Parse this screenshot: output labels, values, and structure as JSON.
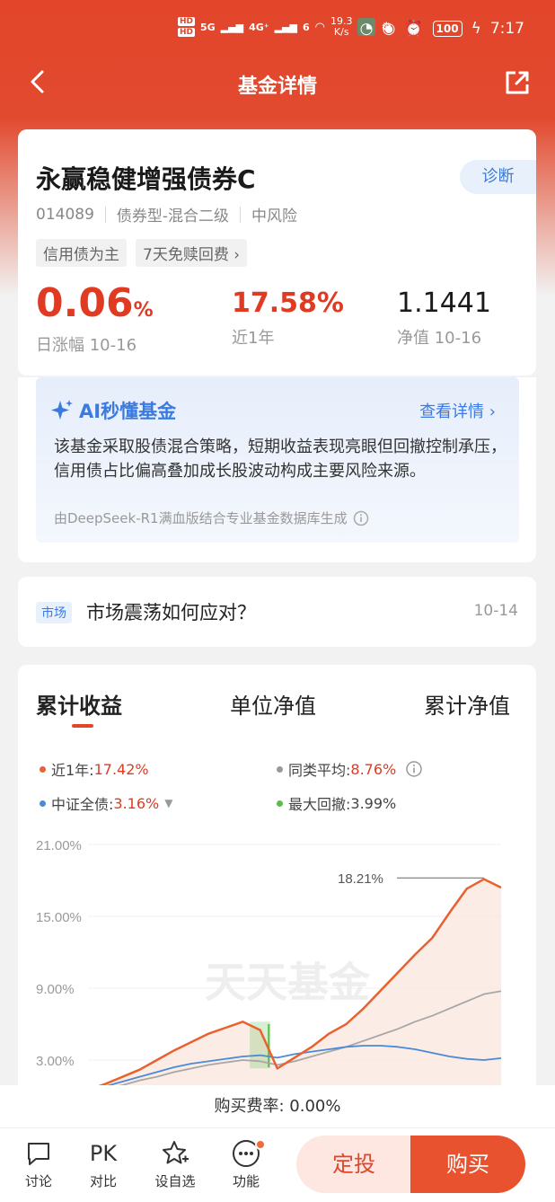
{
  "status_bar": {
    "hd1": "HD",
    "hd2": "HD",
    "net1": "5G",
    "net2": "4G⁺",
    "wifi_num": "6",
    "speed_val": "19.3",
    "speed_unit": "K/s",
    "battery": "100",
    "time": "7:17"
  },
  "nav": {
    "title": "基金详情",
    "back_icon": "chevron-left-icon",
    "share_icon": "share-icon"
  },
  "fund": {
    "name": "永赢稳健增强债券C",
    "diagnose_label": "诊断",
    "code": "014089",
    "type": "债券型-混合二级",
    "risk": "中风险",
    "tags": [
      "信用债为主",
      "7天免赎回费"
    ],
    "daily_change": "0.06",
    "daily_unit": "%",
    "daily_label": "日涨幅 10-16",
    "year_return": "17.58%",
    "year_label": "近1年",
    "nav_value": "1.1441",
    "nav_label": "净值 10-16"
  },
  "ai": {
    "title": "AI秒懂基金",
    "more": "查看详情",
    "text": "该基金采取股债混合策略，短期收益表现亮眼但回撤控制承压，信用债占比偏高叠加成长股波动构成主要风险来源。",
    "source": "由DeepSeek-R1满血版结合专业基金数据库生成"
  },
  "market": {
    "tag": "市场",
    "title": "市场震荡如何应对？",
    "date": "10-14"
  },
  "chart_tabs": [
    "累计收益",
    "单位净值",
    "累计净值"
  ],
  "legend": {
    "l1_label": "近1年:",
    "l1_value": "17.42%",
    "l2_label": "同类平均:",
    "l2_value": "8.76%",
    "l3_label": "中证全债:",
    "l3_value": "3.16%",
    "l4_label": "最大回撤:",
    "l4_value": "3.99%"
  },
  "colors": {
    "fund": "#e8622f",
    "peer": "#a7a7a7",
    "index": "#4a8ad8",
    "drawdown": "#5bbb4b",
    "accent": "#e2452a"
  },
  "chart_data": {
    "type": "line",
    "ylim": [
      0,
      21
    ],
    "yticks": [
      "21.00%",
      "15.00%",
      "9.00%",
      "3.00%"
    ],
    "ytick_values": [
      21,
      15,
      9,
      3
    ],
    "annotation": "18.21%",
    "watermark": "天天基金",
    "x": [
      0,
      1,
      2,
      3,
      4,
      5,
      6,
      7,
      8,
      9,
      10,
      11,
      12,
      13,
      14,
      15,
      16,
      17,
      18,
      19,
      20,
      21,
      22,
      23,
      24
    ],
    "series": [
      {
        "name": "近1年",
        "values": [
          0.5,
          1.0,
          1.6,
          2.2,
          3.0,
          3.8,
          4.5,
          5.2,
          5.7,
          6.2,
          5.5,
          2.3,
          3.2,
          4.1,
          5.2,
          6.0,
          7.3,
          8.8,
          10.3,
          11.8,
          13.2,
          15.3,
          17.3,
          18.1,
          17.4
        ]
      },
      {
        "name": "同类平均",
        "values": [
          0.3,
          0.6,
          0.9,
          1.3,
          1.6,
          2.0,
          2.3,
          2.6,
          2.8,
          3.0,
          2.9,
          2.6,
          2.9,
          3.3,
          3.7,
          4.1,
          4.6,
          5.1,
          5.6,
          6.2,
          6.7,
          7.3,
          7.9,
          8.5,
          8.76
        ]
      },
      {
        "name": "中证全债",
        "values": [
          0.4,
          0.8,
          1.2,
          1.6,
          2.0,
          2.4,
          2.7,
          2.9,
          3.1,
          3.3,
          3.4,
          3.2,
          3.5,
          3.7,
          3.9,
          4.1,
          4.2,
          4.2,
          4.1,
          3.9,
          3.6,
          3.3,
          3.1,
          3.0,
          3.16
        ]
      }
    ]
  },
  "fee": "购买费率: 0.00%",
  "bottom": {
    "discuss": "讨论",
    "pk_icon_text": "PK",
    "compare": "对比",
    "watch": "设自选",
    "more": "功能",
    "dingtou": "定投",
    "buy": "购买"
  }
}
